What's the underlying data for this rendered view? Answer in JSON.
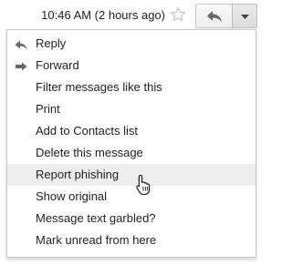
{
  "header": {
    "timestamp": "10:46 AM (2 hours ago)",
    "star_icon": "star-icon",
    "reply_icon": "reply-arrow-icon",
    "more_icon": "dropdown-arrow-icon"
  },
  "menu": {
    "items": [
      {
        "label": "Reply",
        "icon": "reply-icon"
      },
      {
        "label": "Forward",
        "icon": "forward-icon"
      },
      {
        "label": "Filter messages like this"
      },
      {
        "label": "Print"
      },
      {
        "label": "Add to Contacts list"
      },
      {
        "label": "Delete this message"
      },
      {
        "label": "Report phishing",
        "hovered": true
      },
      {
        "label": "Show original"
      },
      {
        "label": "Message text garbled?"
      },
      {
        "label": "Mark unread from here"
      }
    ]
  },
  "colors": {
    "hover_bg": "#eeeeee",
    "text": "#222222",
    "icon": "#666666"
  }
}
